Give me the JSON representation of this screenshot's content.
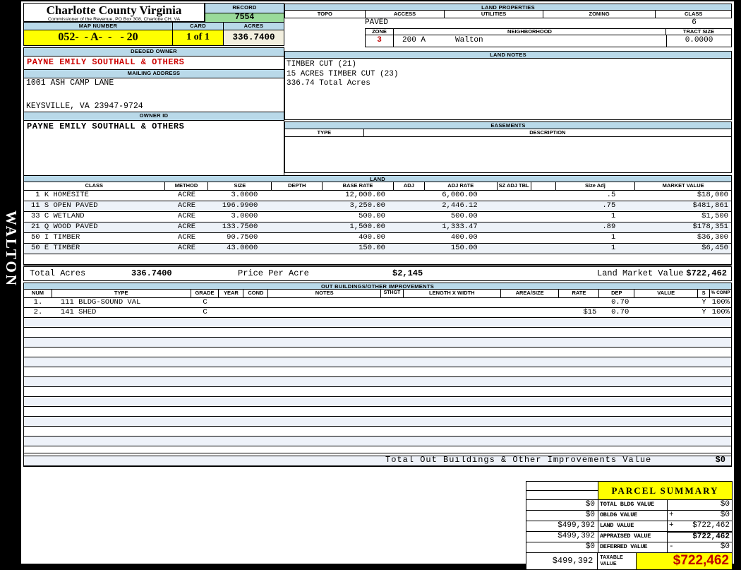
{
  "sidebar": {
    "label": "WALTON"
  },
  "header": {
    "title": "Charlotte County Virginia",
    "subtitle": "Commissioner of the Revenue, PO Box 308, Charlotte CH, VA",
    "record_label": "RECORD",
    "record_value": "7554",
    "map_label": "MAP NUMBER",
    "map_value": "052-  - A-  -   - 20",
    "card_label": "CARD",
    "card_value": "1 of 1",
    "acres_label": "ACRES",
    "acres_value": "336.7400"
  },
  "owner": {
    "deeded_label": "DEEDED OWNER",
    "deeded_value": "PAYNE EMILY SOUTHALL & OTHERS",
    "mailing_label": "MAILING ADDRESS",
    "address_line1": "1001 ASH CAMP LANE",
    "address_line2": "KEYSVILLE, VA 23947-9724",
    "owner_id_label": "OWNER ID",
    "owner_id_value": "PAYNE EMILY SOUTHALL & OTHERS"
  },
  "land_properties": {
    "title": "LAND PROPERTIES",
    "headers": [
      "TOPO",
      "ACCESS",
      "UTILITIES",
      "ZONING",
      "CLASS"
    ],
    "topo": "",
    "access": "PAVED",
    "utilities": "",
    "zoning": "",
    "class": "6",
    "zone_label": "ZONE",
    "zone": "3",
    "neighborhood_label": "NEIGHBORHOOD",
    "neighborhood_code": "200 A",
    "neighborhood_name": "Walton",
    "tract_label": "TRACT SIZE",
    "tract_size": "0.0000"
  },
  "land_notes": {
    "title": "LAND NOTES",
    "line1": "TIMBER CUT (21)",
    "line2": "15 ACRES TIMBER CUT (23)",
    "line3": "336.74 Total Acres"
  },
  "easements": {
    "title": "EASEMENTS",
    "type_label": "TYPE",
    "description_label": "DESCRIPTION"
  },
  "land": {
    "title": "LAND",
    "headers": [
      "CLASS",
      "METHOD",
      "SIZE",
      "DEPTH",
      "BASE RATE",
      "ADJ",
      "ADJ RATE",
      "SZ ADJ TBL",
      "",
      "Size Adj",
      "MARKET VALUE"
    ],
    "rows": [
      {
        "class": " 1 K HOMESITE",
        "method": "ACRE",
        "size": "3.0000",
        "base_rate": "12,000.00",
        "adj_rate": "6,000.00",
        "size_adj": ".5",
        "market_value": "$18,000"
      },
      {
        "class": "11 S OPEN PAVED",
        "method": "ACRE",
        "size": "196.9900",
        "base_rate": "3,250.00",
        "adj_rate": "2,446.12",
        "size_adj": ".75",
        "market_value": "$481,861"
      },
      {
        "class": "33 C WETLAND",
        "method": "ACRE",
        "size": "3.0000",
        "base_rate": "500.00",
        "adj_rate": "500.00",
        "size_adj": "1",
        "market_value": "$1,500"
      },
      {
        "class": "21 Q WOOD PAVED",
        "method": "ACRE",
        "size": "133.7500",
        "base_rate": "1,500.00",
        "adj_rate": "1,333.47",
        "size_adj": ".89",
        "market_value": "$178,351"
      },
      {
        "class": "50 I TIMBER",
        "method": "ACRE",
        "size": "90.7500",
        "base_rate": "400.00",
        "adj_rate": "400.00",
        "size_adj": "1",
        "market_value": "$36,300"
      },
      {
        "class": "50 E TIMBER",
        "method": "ACRE",
        "size": "43.0000",
        "base_rate": "150.00",
        "adj_rate": "150.00",
        "size_adj": "1",
        "market_value": "$6,450"
      }
    ],
    "total_acres_label": "Total Acres",
    "total_acres": "336.7400",
    "price_per_acre_label": "Price Per Acre",
    "price_per_acre": "$2,145",
    "market_value_label": "Land Market Value",
    "market_value": "$722,462"
  },
  "out_buildings": {
    "title": "OUT BUILDINGS/OTHER IMPROVEMENTS",
    "headers": [
      "NUM",
      "TYPE",
      "GRADE",
      "YEAR",
      "COND",
      "NOTES",
      "STHGT",
      "LENGTH X WIDTH",
      "AREA/SIZE",
      "RATE",
      "DEP",
      "VALUE",
      "S",
      "% COMP"
    ],
    "rows": [
      {
        "num": "1.",
        "type": "111 BLDG-SOUND VAL",
        "grade": "C",
        "year": "",
        "cond": "",
        "notes": "",
        "sthgt": "",
        "lxw": "",
        "area": "",
        "rate": "",
        "dep": "0.70",
        "value": "",
        "s": "Y",
        "comp": "100%"
      },
      {
        "num": "2.",
        "type": "141 SHED",
        "grade": "C",
        "year": "",
        "cond": "",
        "notes": "",
        "sthgt": "",
        "lxw": "",
        "area": "",
        "rate": "$15",
        "dep": "0.70",
        "value": "",
        "s": "Y",
        "comp": "100%"
      }
    ],
    "total_label": "Total Out Buildings & Other Improvements Value",
    "total_value": "$0"
  },
  "parcel_summary": {
    "title": "PARCEL SUMMARY",
    "rows": [
      {
        "left": "$0",
        "label": "TOTAL BLDG VALUE",
        "op": "",
        "value": "$0"
      },
      {
        "left": "$0",
        "label": "OBLDG VALUE",
        "op": "+",
        "value": "$0"
      },
      {
        "left": "$499,392",
        "label": "LAND VALUE",
        "op": "+",
        "value": "$722,462"
      },
      {
        "left": "$499,392",
        "label": "APPRAISED VALUE",
        "op": "",
        "value": "$722,462"
      },
      {
        "left": "$0",
        "label": "DEFERRED VALUE",
        "op": "-",
        "value": "$0"
      }
    ],
    "taxable_left": "$499,392",
    "taxable_label": "TAXABLE VALUE",
    "taxable_value": "$722,462"
  },
  "colors": {
    "band_blue": "#B9D9E9",
    "record_green": "#9ADB9A",
    "highlight_yellow": "#FFFF00",
    "acres_cream": "#F2EFDF",
    "owner_red": "#CC0000",
    "stripe_blue": "#EDF2F8"
  }
}
